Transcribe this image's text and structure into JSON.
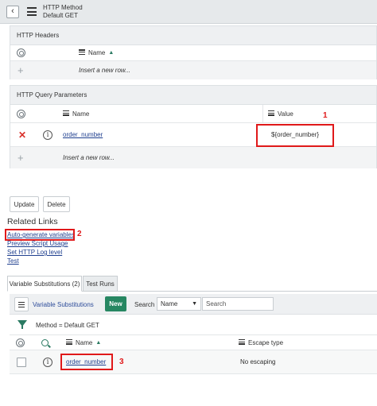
{
  "header": {
    "title": "HTTP Method",
    "subtitle": "Default GET"
  },
  "http_headers": {
    "section_title": "HTTP Headers",
    "columns": {
      "name": "Name"
    },
    "insert_row": "Insert a new row..."
  },
  "query_params": {
    "section_title": "HTTP Query Parameters",
    "columns": {
      "name": "Name",
      "value": "Value"
    },
    "rows": [
      {
        "name": "order_number",
        "value": "${order_number}"
      }
    ],
    "insert_row": "Insert a new row..."
  },
  "actions": {
    "update": "Update",
    "delete": "Delete"
  },
  "related_links": {
    "title": "Related Links",
    "links": [
      "Auto-generate variables",
      "Preview Script Usage",
      "Set HTTP Log level",
      "Test"
    ]
  },
  "tabs": [
    {
      "label": "Variable Substitutions (2)",
      "active": true
    },
    {
      "label": "Test Runs",
      "active": false
    }
  ],
  "list": {
    "title": "Variable Substitutions",
    "new_label": "New",
    "search_label": "Search",
    "search_field": "Name",
    "search_placeholder": "Search",
    "filter": "Method = Default GET",
    "columns": {
      "name": "Name",
      "escape": "Escape type"
    },
    "rows": [
      {
        "name": "order_number",
        "escape": "No escaping"
      }
    ]
  },
  "annotations": [
    "1",
    "2",
    "3"
  ],
  "colors": {
    "annotation": "#e0191a",
    "accent_green": "#278762",
    "link": "#1f3f8f"
  }
}
